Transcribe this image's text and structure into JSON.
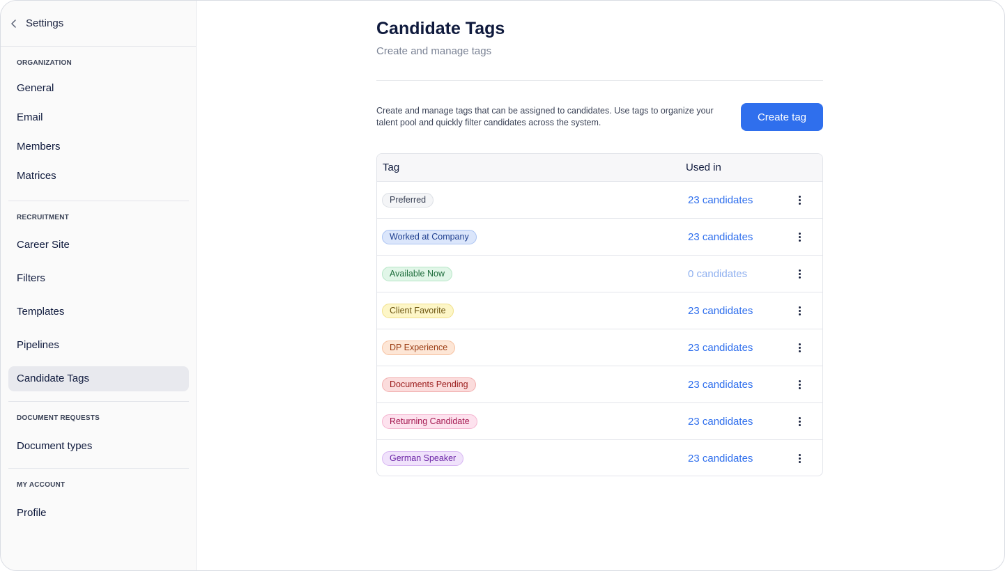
{
  "sidebar": {
    "back_label": "Settings",
    "sections": [
      {
        "title": "ORGANIZATION",
        "items": [
          "General",
          "Email",
          "Members",
          "Matrices"
        ]
      },
      {
        "title": "RECRUITMENT",
        "items": [
          "Career Site",
          "Filters",
          "Templates",
          "Pipelines",
          "Candidate Tags"
        ]
      },
      {
        "title": "DOCUMENT REQUESTS",
        "items": [
          "Document types"
        ]
      },
      {
        "title": "MY ACCOUNT",
        "items": [
          "Profile"
        ]
      }
    ],
    "active_item": "Candidate Tags"
  },
  "main": {
    "title": "Candidate Tags",
    "subtitle": "Create and manage tags",
    "description": "Create and manage tags that can be assigned to candidates. Use tags to organize your talent pool and quickly filter candidates across the system.",
    "create_button": "Create tag",
    "table": {
      "col_tag": "Tag",
      "col_used": "Used in",
      "rows": [
        {
          "tag": "Preferred",
          "used": "23 candidates",
          "bg": "#f4f5f7",
          "border": "#dcdfe5",
          "fg": "#3a4256"
        },
        {
          "tag": "Worked at Company",
          "used": "23 candidates",
          "bg": "#dbe6fb",
          "border": "#a9c2f2",
          "fg": "#1f3f8f"
        },
        {
          "tag": "Available Now",
          "used": "0 candidates",
          "bg": "#e1f6e8",
          "border": "#b5e6c6",
          "fg": "#1c6b3a"
        },
        {
          "tag": "Client Favorite",
          "used": "23 candidates",
          "bg": "#fdf6c7",
          "border": "#f1e08a",
          "fg": "#6b5410"
        },
        {
          "tag": "DP Experience",
          "used": "23 candidates",
          "bg": "#fde6d6",
          "border": "#f6c1a0",
          "fg": "#9a3b12"
        },
        {
          "tag": "Documents Pending",
          "used": "23 candidates",
          "bg": "#fbdcdc",
          "border": "#f2b0b0",
          "fg": "#9b1c1c"
        },
        {
          "tag": "Returning Candidate",
          "used": "23 candidates",
          "bg": "#fde2ee",
          "border": "#f4b3cf",
          "fg": "#a3174f"
        },
        {
          "tag": "German Speaker",
          "used": "23 candidates",
          "bg": "#f0e2fb",
          "border": "#d7b6f2",
          "fg": "#6b24a6"
        }
      ]
    },
    "colors": {
      "link": "#2f6fed",
      "link_muted": "#8fb0ef",
      "primary": "#2f6fed"
    }
  }
}
